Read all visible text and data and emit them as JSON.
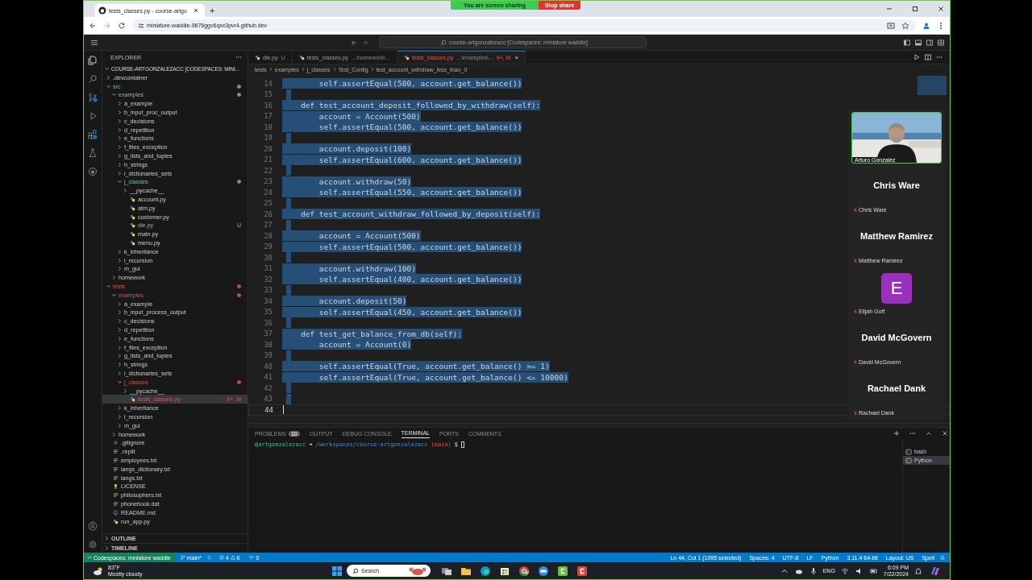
{
  "browser": {
    "tab_title": "tests_classes.py - course-artgo",
    "new_tab": "+",
    "address": "miniature-waddle-9676ggv6qxx3pvr4.github.dev"
  },
  "share_bar": {
    "status": "You are screen sharing",
    "stop": "Stop share"
  },
  "vscode": {
    "command_center": "course-artgonzalezacc [Codespaces: miniature waddle]"
  },
  "explorer": {
    "title": "EXPLORER",
    "root": "COURSE-ARTGONZALEZACC [CODESPACES: MINI...",
    "tree": [
      {
        "label": ".devcontainer",
        "kind": "folder",
        "expanded": false,
        "changed": false,
        "error": false,
        "selected": false
      },
      {
        "label": "src",
        "kind": "folder",
        "expanded": true,
        "changed": true,
        "error": false,
        "selected": false,
        "children": [
          {
            "label": "examples",
            "kind": "folder",
            "expanded": true,
            "changed": true,
            "error": false,
            "selected": false,
            "children": [
              {
                "label": "a_example",
                "kind": "folder",
                "expanded": false,
                "changed": false,
                "error": false,
                "selected": false
              },
              {
                "label": "b_input_proc_output",
                "kind": "folder",
                "expanded": false,
                "changed": false,
                "error": false,
                "selected": false
              },
              {
                "label": "c_decisions",
                "kind": "folder",
                "expanded": false,
                "changed": false,
                "error": false,
                "selected": false
              },
              {
                "label": "d_repetition",
                "kind": "folder",
                "expanded": false,
                "changed": false,
                "error": false,
                "selected": false
              },
              {
                "label": "e_functions",
                "kind": "folder",
                "expanded": false,
                "changed": false,
                "error": false,
                "selected": false
              },
              {
                "label": "f_files_exception",
                "kind": "folder",
                "expanded": false,
                "changed": false,
                "error": false,
                "selected": false
              },
              {
                "label": "g_lists_and_tuples",
                "kind": "folder",
                "expanded": false,
                "changed": false,
                "error": false,
                "selected": false
              },
              {
                "label": "h_strings",
                "kind": "folder",
                "expanded": false,
                "changed": false,
                "error": false,
                "selected": false
              },
              {
                "label": "i_dictionaries_sets",
                "kind": "folder",
                "expanded": false,
                "changed": false,
                "error": false,
                "selected": false
              },
              {
                "label": "j_classes",
                "kind": "folder",
                "expanded": true,
                "changed": true,
                "error": false,
                "selected": false,
                "children": [
                  {
                    "label": "__pycache__",
                    "kind": "folder",
                    "expanded": false,
                    "changed": false,
                    "error": false,
                    "selected": false
                  },
                  {
                    "label": "account.py",
                    "kind": "python",
                    "changed": false,
                    "error": false,
                    "selected": false
                  },
                  {
                    "label": "atm.py",
                    "kind": "python",
                    "changed": false,
                    "error": false,
                    "selected": false
                  },
                  {
                    "label": "customer.py",
                    "kind": "python",
                    "changed": false,
                    "error": false,
                    "selected": false
                  },
                  {
                    "label": "die.py",
                    "kind": "python",
                    "changed": true,
                    "error": false,
                    "badge": "U",
                    "selected": false
                  },
                  {
                    "label": "main.py",
                    "kind": "python",
                    "changed": false,
                    "error": false,
                    "selected": false
                  },
                  {
                    "label": "menu.py",
                    "kind": "python",
                    "changed": false,
                    "error": false,
                    "selected": false
                  }
                ]
              },
              {
                "label": "k_inheritance",
                "kind": "folder",
                "expanded": false,
                "changed": false,
                "error": false,
                "selected": false
              },
              {
                "label": "l_recursion",
                "kind": "folder",
                "expanded": false,
                "changed": false,
                "error": false,
                "selected": false
              },
              {
                "label": "m_gui",
                "kind": "folder",
                "expanded": false,
                "changed": false,
                "error": false,
                "selected": false
              }
            ]
          },
          {
            "label": "homework",
            "kind": "folder",
            "expanded": false,
            "changed": false,
            "error": false,
            "selected": false
          }
        ]
      },
      {
        "label": "tests",
        "kind": "folder",
        "expanded": true,
        "changed": false,
        "error": true,
        "selected": false,
        "children": [
          {
            "label": "examples",
            "kind": "folder",
            "expanded": true,
            "changed": false,
            "error": true,
            "selected": false,
            "children": [
              {
                "label": "a_example",
                "kind": "folder",
                "expanded": false,
                "changed": false,
                "error": false,
                "selected": false
              },
              {
                "label": "b_input_process_output",
                "kind": "folder",
                "expanded": false,
                "changed": false,
                "error": false,
                "selected": false
              },
              {
                "label": "c_decisions",
                "kind": "folder",
                "expanded": false,
                "changed": false,
                "error": false,
                "selected": false
              },
              {
                "label": "d_repetition",
                "kind": "folder",
                "expanded": false,
                "changed": false,
                "error": false,
                "selected": false
              },
              {
                "label": "e_functions",
                "kind": "folder",
                "expanded": false,
                "changed": false,
                "error": false,
                "selected": false
              },
              {
                "label": "f_files_exception",
                "kind": "folder",
                "expanded": false,
                "changed": false,
                "error": false,
                "selected": false
              },
              {
                "label": "g_lists_and_tuples",
                "kind": "folder",
                "expanded": false,
                "changed": false,
                "error": false,
                "selected": false
              },
              {
                "label": "h_strings",
                "kind": "folder",
                "expanded": false,
                "changed": false,
                "error": false,
                "selected": false
              },
              {
                "label": "i_dictionaries_sets",
                "kind": "folder",
                "expanded": false,
                "changed": false,
                "error": false,
                "selected": false
              },
              {
                "label": "j_classes",
                "kind": "folder",
                "expanded": true,
                "changed": false,
                "error": true,
                "selected": false,
                "children": [
                  {
                    "label": "__pycache__",
                    "kind": "folder",
                    "expanded": false,
                    "changed": false,
                    "error": false,
                    "selected": false
                  },
                  {
                    "label": "tests_classes.py",
                    "kind": "python",
                    "changed": false,
                    "error": true,
                    "badge": "9+, M",
                    "selected": true
                  }
                ]
              },
              {
                "label": "k_inheritance",
                "kind": "folder",
                "expanded": false,
                "changed": false,
                "error": false,
                "selected": false
              },
              {
                "label": "l_recursion",
                "kind": "folder",
                "expanded": false,
                "changed": false,
                "error": false,
                "selected": false
              },
              {
                "label": "m_gui",
                "kind": "folder",
                "expanded": false,
                "changed": false,
                "error": false,
                "selected": false
              }
            ]
          },
          {
            "label": "homework",
            "kind": "folder",
            "expanded": false,
            "changed": false,
            "error": false,
            "selected": false
          }
        ]
      },
      {
        "label": ".gitignore",
        "kind": "git",
        "changed": false,
        "error": false,
        "selected": false
      },
      {
        "label": ".replit",
        "kind": "text",
        "changed": false,
        "error": false,
        "selected": false
      },
      {
        "label": "employees.txt",
        "kind": "text",
        "changed": false,
        "error": false,
        "selected": false
      },
      {
        "label": "langs_dictionary.txt",
        "kind": "text",
        "changed": false,
        "error": false,
        "selected": false
      },
      {
        "label": "langs.txt",
        "kind": "text",
        "changed": false,
        "error": false,
        "selected": false
      },
      {
        "label": "LICENSE",
        "kind": "license",
        "changed": false,
        "error": false,
        "selected": false
      },
      {
        "label": "philosophers.txt",
        "kind": "text",
        "changed": false,
        "error": false,
        "selected": false
      },
      {
        "label": "phonebook.dat",
        "kind": "text",
        "changed": false,
        "error": false,
        "selected": false
      },
      {
        "label": "README.md",
        "kind": "info",
        "changed": false,
        "error": false,
        "selected": false
      },
      {
        "label": "run_app.py",
        "kind": "python",
        "changed": false,
        "error": false,
        "selected": false
      }
    ],
    "outline": "OUTLINE",
    "timeline": "TIMELINE"
  },
  "tabs": [
    {
      "label": "die.py",
      "hint": "U",
      "selected": false
    },
    {
      "label": "tests_classes.py",
      "hint": "...\\homework\\...",
      "selected": false
    },
    {
      "label": "tests_classes.py",
      "hint": "...\\examples\\...",
      "status": "9+, M",
      "close": "×",
      "selected": true
    }
  ],
  "breadcrumbs": [
    "tests",
    "examples",
    "j_classes",
    "Test_Config",
    "test_account_withdraw_less_than_0"
  ],
  "code": [
    {
      "number": "14",
      "text": "        self.assertEqual(500, account.get_balance())",
      "selected": true
    },
    {
      "number": "15",
      "selected": true
    },
    {
      "number": "16",
      "text": "    def test_account_deposit_followed_by_withdraw(self):",
      "selected": true
    },
    {
      "number": "17",
      "text": "        account = Account(500)",
      "selected": true
    },
    {
      "number": "18",
      "text": "        self.assertEqual(500, account.get_balance())",
      "selected": true
    },
    {
      "number": "19",
      "selected": true
    },
    {
      "number": "20",
      "text": "        account.deposit(100)",
      "selected": true
    },
    {
      "number": "21",
      "text": "        self.assertEqual(600, account.get_balance())",
      "selected": true
    },
    {
      "number": "22",
      "selected": true
    },
    {
      "number": "23",
      "text": "        account.withdraw(50)",
      "selected": true
    },
    {
      "number": "24",
      "text": "        self.assertEqual(550, account.get_balance())",
      "selected": true
    },
    {
      "number": "25",
      "selected": true
    },
    {
      "number": "26",
      "text": "    def test_account_withdraw_followed_by_deposit(self):",
      "selected": true
    },
    {
      "number": "27",
      "selected": true
    },
    {
      "number": "28",
      "text": "        account = Account(500)",
      "selected": true
    },
    {
      "number": "29",
      "text": "        self.assertEqual(500, account.get_balance())",
      "selected": true
    },
    {
      "number": "30",
      "selected": true
    },
    {
      "number": "31",
      "text": "        account.withdraw(100)",
      "selected": true
    },
    {
      "number": "32",
      "text": "        self.assertEqual(400, account.get_balance())",
      "selected": true
    },
    {
      "number": "33",
      "selected": true
    },
    {
      "number": "34",
      "text": "        account.deposit(50)",
      "selected": true
    },
    {
      "number": "35",
      "text": "        self.assertEqual(450, account.get_balance())",
      "selected": true
    },
    {
      "number": "36",
      "selected": true
    },
    {
      "number": "37",
      "text": "    def test_get_balance_from_db(self):",
      "selected": true
    },
    {
      "number": "38",
      "text": "        account = Account(0)",
      "selected": true
    },
    {
      "number": "39",
      "selected": true
    },
    {
      "number": "40",
      "text": "        self.assertEqual(True, account.get_balance() >= 1)",
      "selected": true
    },
    {
      "number": "41",
      "text": "        self.assertEqual(True, account.get_balance() <= 10000)",
      "selected": true
    },
    {
      "number": "42",
      "selected": true
    },
    {
      "number": "43",
      "selected": true
    },
    {
      "number": "44",
      "selected": false
    }
  ],
  "participants": [
    {
      "kind": "video",
      "name": "Arturo Gonzalez"
    },
    {
      "kind": "name",
      "title": "Chris Ware",
      "name": "Chris Ware",
      "muted": true
    },
    {
      "kind": "name",
      "title": "Matthew Ramirez",
      "name": "Matthew Ramirez",
      "muted": true
    },
    {
      "kind": "avatar",
      "title": "E",
      "name": "Elijah Goff",
      "muted": true
    },
    {
      "kind": "name",
      "title": "David McGovern",
      "name": "David McGovern",
      "muted": true
    },
    {
      "kind": "name",
      "title": "Rachael Dank",
      "name": "Rachael Dank",
      "muted": true
    }
  ],
  "panel": {
    "tabs": [
      {
        "label": "PROBLEMS",
        "count": "10",
        "selected": false
      },
      {
        "label": "OUTPUT",
        "selected": false
      },
      {
        "label": "DEBUG CONSOLE",
        "selected": false
      },
      {
        "label": "TERMINAL",
        "selected": true
      },
      {
        "label": "PORTS",
        "selected": false
      },
      {
        "label": "COMMENTS",
        "selected": false
      }
    ],
    "terminal": {
      "user": "@artgonzalezacc",
      "arrow": "➜",
      "path": "/workspaces/course-artgonzalezacc",
      "branch": "(main)",
      "prompt": "$"
    },
    "terminals": [
      {
        "label": "bash",
        "selected": false
      },
      {
        "label": "Python",
        "selected": true
      }
    ]
  },
  "status_bar": {
    "remote": "Codespaces: miniature waddle",
    "branch": "main*",
    "errors": "4",
    "warnings": "6",
    "ports": "0",
    "right": [
      "Ln 44, Col 1 (1095 selected)",
      "Spaces: 4",
      "UTF-8",
      "LF",
      "Python",
      "3.11.4 64-bit",
      "Layout: US",
      "Spell"
    ]
  },
  "taskbar": {
    "temperature": "83°F",
    "weather": "Mostly cloudy",
    "search": "Search",
    "language": "ENG",
    "time": "6:09 PM",
    "date": "7/22/2024"
  }
}
